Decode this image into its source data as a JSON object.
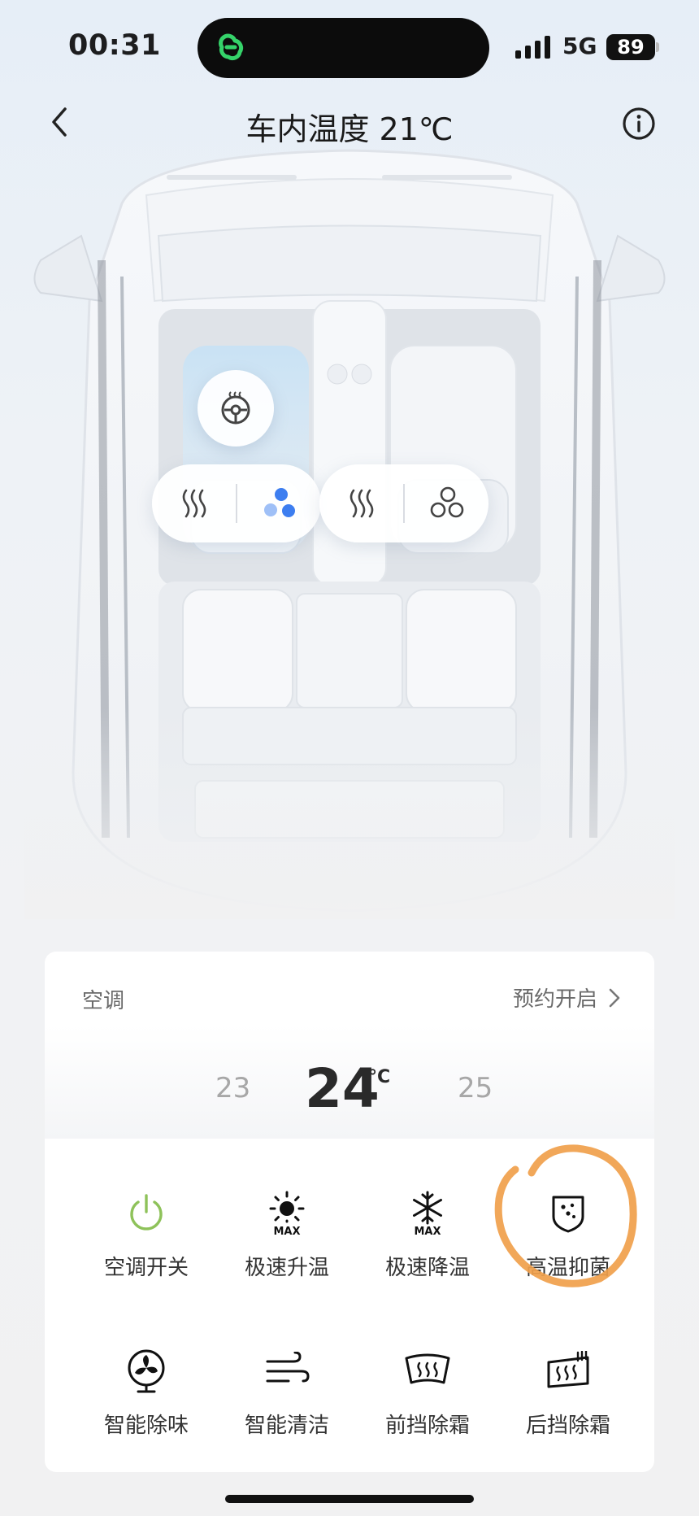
{
  "status_bar": {
    "time": "00:31",
    "network": "5G",
    "battery": "89"
  },
  "nav": {
    "title": "车内温度 21℃"
  },
  "ac": {
    "title": "空调",
    "schedule_label": "预约开启",
    "temp_low": "23",
    "temp_current": "24",
    "temp_unit": "°C",
    "temp_high": "25",
    "controls": [
      {
        "label": "空调开关",
        "icon": "power-icon",
        "color": "#8ec25a"
      },
      {
        "label": "极速升温",
        "icon": "sun-max-icon"
      },
      {
        "label": "极速降温",
        "icon": "snowflake-max-icon"
      },
      {
        "label": "高温抑菌",
        "icon": "shield-bacteria-icon"
      },
      {
        "label": "智能除味",
        "icon": "fan-icon"
      },
      {
        "label": "智能清洁",
        "icon": "wind-icon"
      },
      {
        "label": "前挡除霜",
        "icon": "front-defrost-icon"
      },
      {
        "label": "后挡除霜",
        "icon": "rear-defrost-icon"
      }
    ]
  },
  "colors": {
    "accent_blue": "#3d7ef0",
    "power_green": "#8ec25a",
    "annotation_orange": "#f0a04b"
  },
  "icons": [
    "back-icon",
    "info-icon",
    "steering-wheel-heat-icon",
    "seat-heat-icon",
    "seat-ventilation-icon"
  ]
}
